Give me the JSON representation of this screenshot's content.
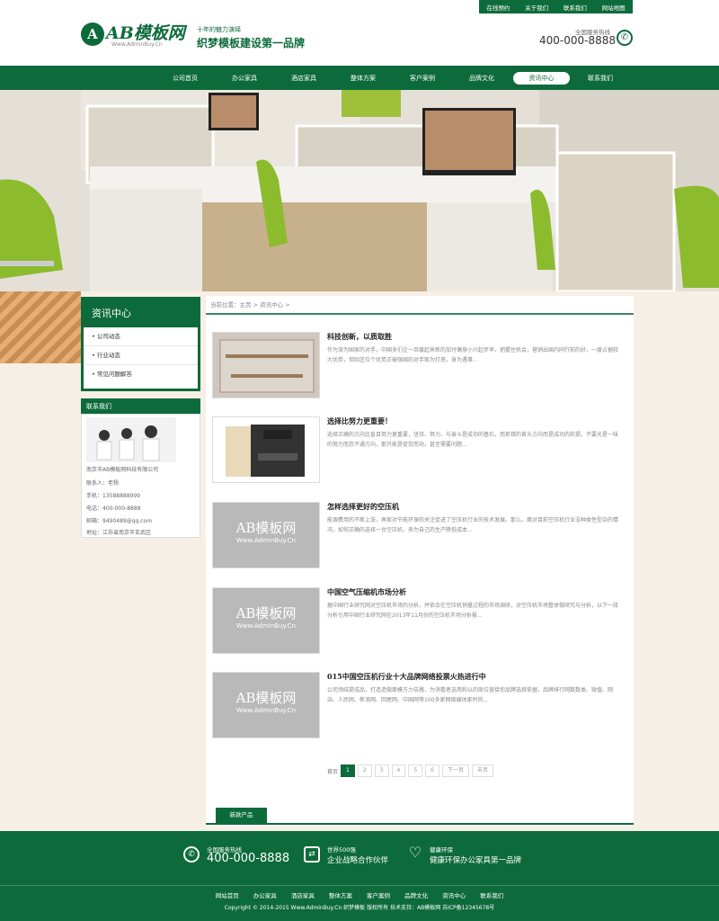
{
  "toplinks": [
    "在线预约",
    "关于我们",
    "联系我们",
    "网站地图"
  ],
  "logo": {
    "mark": "A",
    "text": "AB模板网",
    "sub": "Www.AdminBuy.Cn"
  },
  "slogan": {
    "small": "十年的魅力演绎",
    "big": "织梦模板建设第一品牌"
  },
  "hotline": {
    "label": "全国服务热线",
    "number": "400-000-8888",
    "icon": "phone-icon"
  },
  "nav": [
    "公司首页",
    "办公家具",
    "酒店家具",
    "整体方案",
    "客户案例",
    "品牌文化",
    "资讯中心",
    "联系我们"
  ],
  "nav_active": "资讯中心",
  "sidebar": {
    "title": "资讯中心",
    "items": [
      "公司动态",
      "行业动态",
      "常见问题解答"
    ]
  },
  "contact": {
    "title": "联系我们",
    "company": "南京市AB模板网科技有限公司",
    "person": "联系人：老杨",
    "mobile": "手机：13588888999",
    "phone": "电话：400-000-8888",
    "email": "邮箱：9490489@qq.com",
    "address": "地址：江苏省南京市玄武区"
  },
  "breadcrumb": {
    "label": "当前位置：",
    "home": "主页",
    "sep": ">",
    "current": "资讯中心",
    "end": ">"
  },
  "news": [
    {
      "title": "科技创新，以质取胜",
      "desc": "作为深为国家的对手，中国多们企一旦缓起来新的加付偶身小兴起步早，把握住机会，营销出国内同行前的好，一度占据较大优势，但际区位个优势正被强国的对手取为打塔，身为遇事..."
    },
    {
      "title": "选择比努力更重要！",
      "desc": "选择正确的方向比盲目努力更重要，坚持、努力、与奋斗是成功的基石，而抓错的首头方向而是成功的前提。不要光是一味的努力而忽不通方向，那只能是徒劳而功，甚至需要问题..."
    },
    {
      "title": "怎样选择更好的空压机",
      "desc": "能源费用的不断上涨，再家对节能环保的关注促进了空压机行业的技术发展。那么，面对目前空压机行业没种类性型杂的情况，如何正确的选择一台空压机，来为自己的生产降低成本..."
    },
    {
      "title": "中国空气压缩机市场分析",
      "desc": "据中国行业研究网对空压机市场的分析，并依余在空压机销量过程的市场调研，对空压机市场整体做研究与分析，以下一段分析引用中国行业研究网在2013年11月份的空压机市场分析报..."
    },
    {
      "title": "015中国空压机行业十大品牌网络投票火热进行中",
      "desc": "公司领结提成品，打造造做面模方力告路，为消看者选用和以的商位营接你品牌选择依据，品牌排行网数数类、微值、网站、人民网、新浪网、回屋网、中国网等100多家网络媒体家时热..."
    }
  ],
  "thumb_placeholder": {
    "main": "AB模板网",
    "sub": "Www.AdminBuy.Cn"
  },
  "pager": {
    "first": "首页",
    "pages": [
      "1",
      "2",
      "3",
      "4",
      "5",
      "6"
    ],
    "next": "下一页",
    "last": "末页",
    "current": "1"
  },
  "new_products": "新款产品",
  "footer": {
    "service_label": "全国服务热线",
    "service_number": "400-000-8888",
    "partner_label": "世界500强",
    "partner_text": "企业战略合作伙伴",
    "eco_label": "健康环保",
    "eco_text": "健康环保办公家具第一品牌",
    "links": [
      "网站首页",
      "办公家具",
      "酒店家具",
      "整体方案",
      "客户案例",
      "品牌文化",
      "资讯中心",
      "联系我们"
    ],
    "copyright": "Copyright © 2014-2015 Www.AdminBuy.Cn 织梦模板 版权所有   技术支持：AB模板网 苏ICP备12345678号"
  },
  "colors": {
    "brand_green": "#0d6b3b"
  }
}
